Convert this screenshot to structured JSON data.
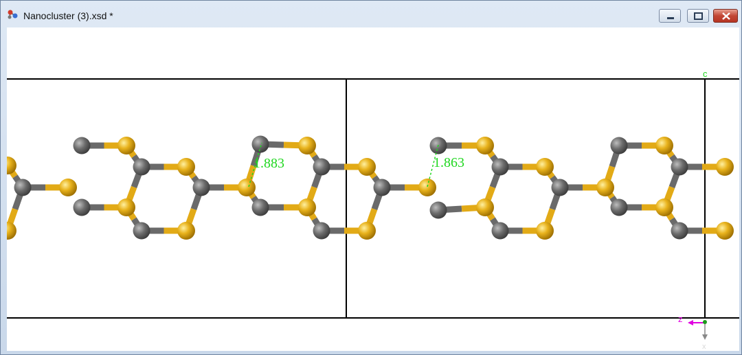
{
  "window": {
    "title": "Nanocluster (3).xsd *",
    "controls": [
      "minimize",
      "maximize",
      "close"
    ]
  },
  "viewer": {
    "measurements": [
      {
        "label": "1.883"
      },
      {
        "label": "1.863"
      }
    ],
    "axes": {
      "up": "c",
      "left": "z",
      "down": "x"
    },
    "colors": {
      "atom_gray": "#6f6f6f",
      "atom_yellow": "#e8b21c",
      "measure_green": "#1fd71f",
      "axis_magenta": "#e000e0",
      "cell_lines": "#000000"
    }
  }
}
